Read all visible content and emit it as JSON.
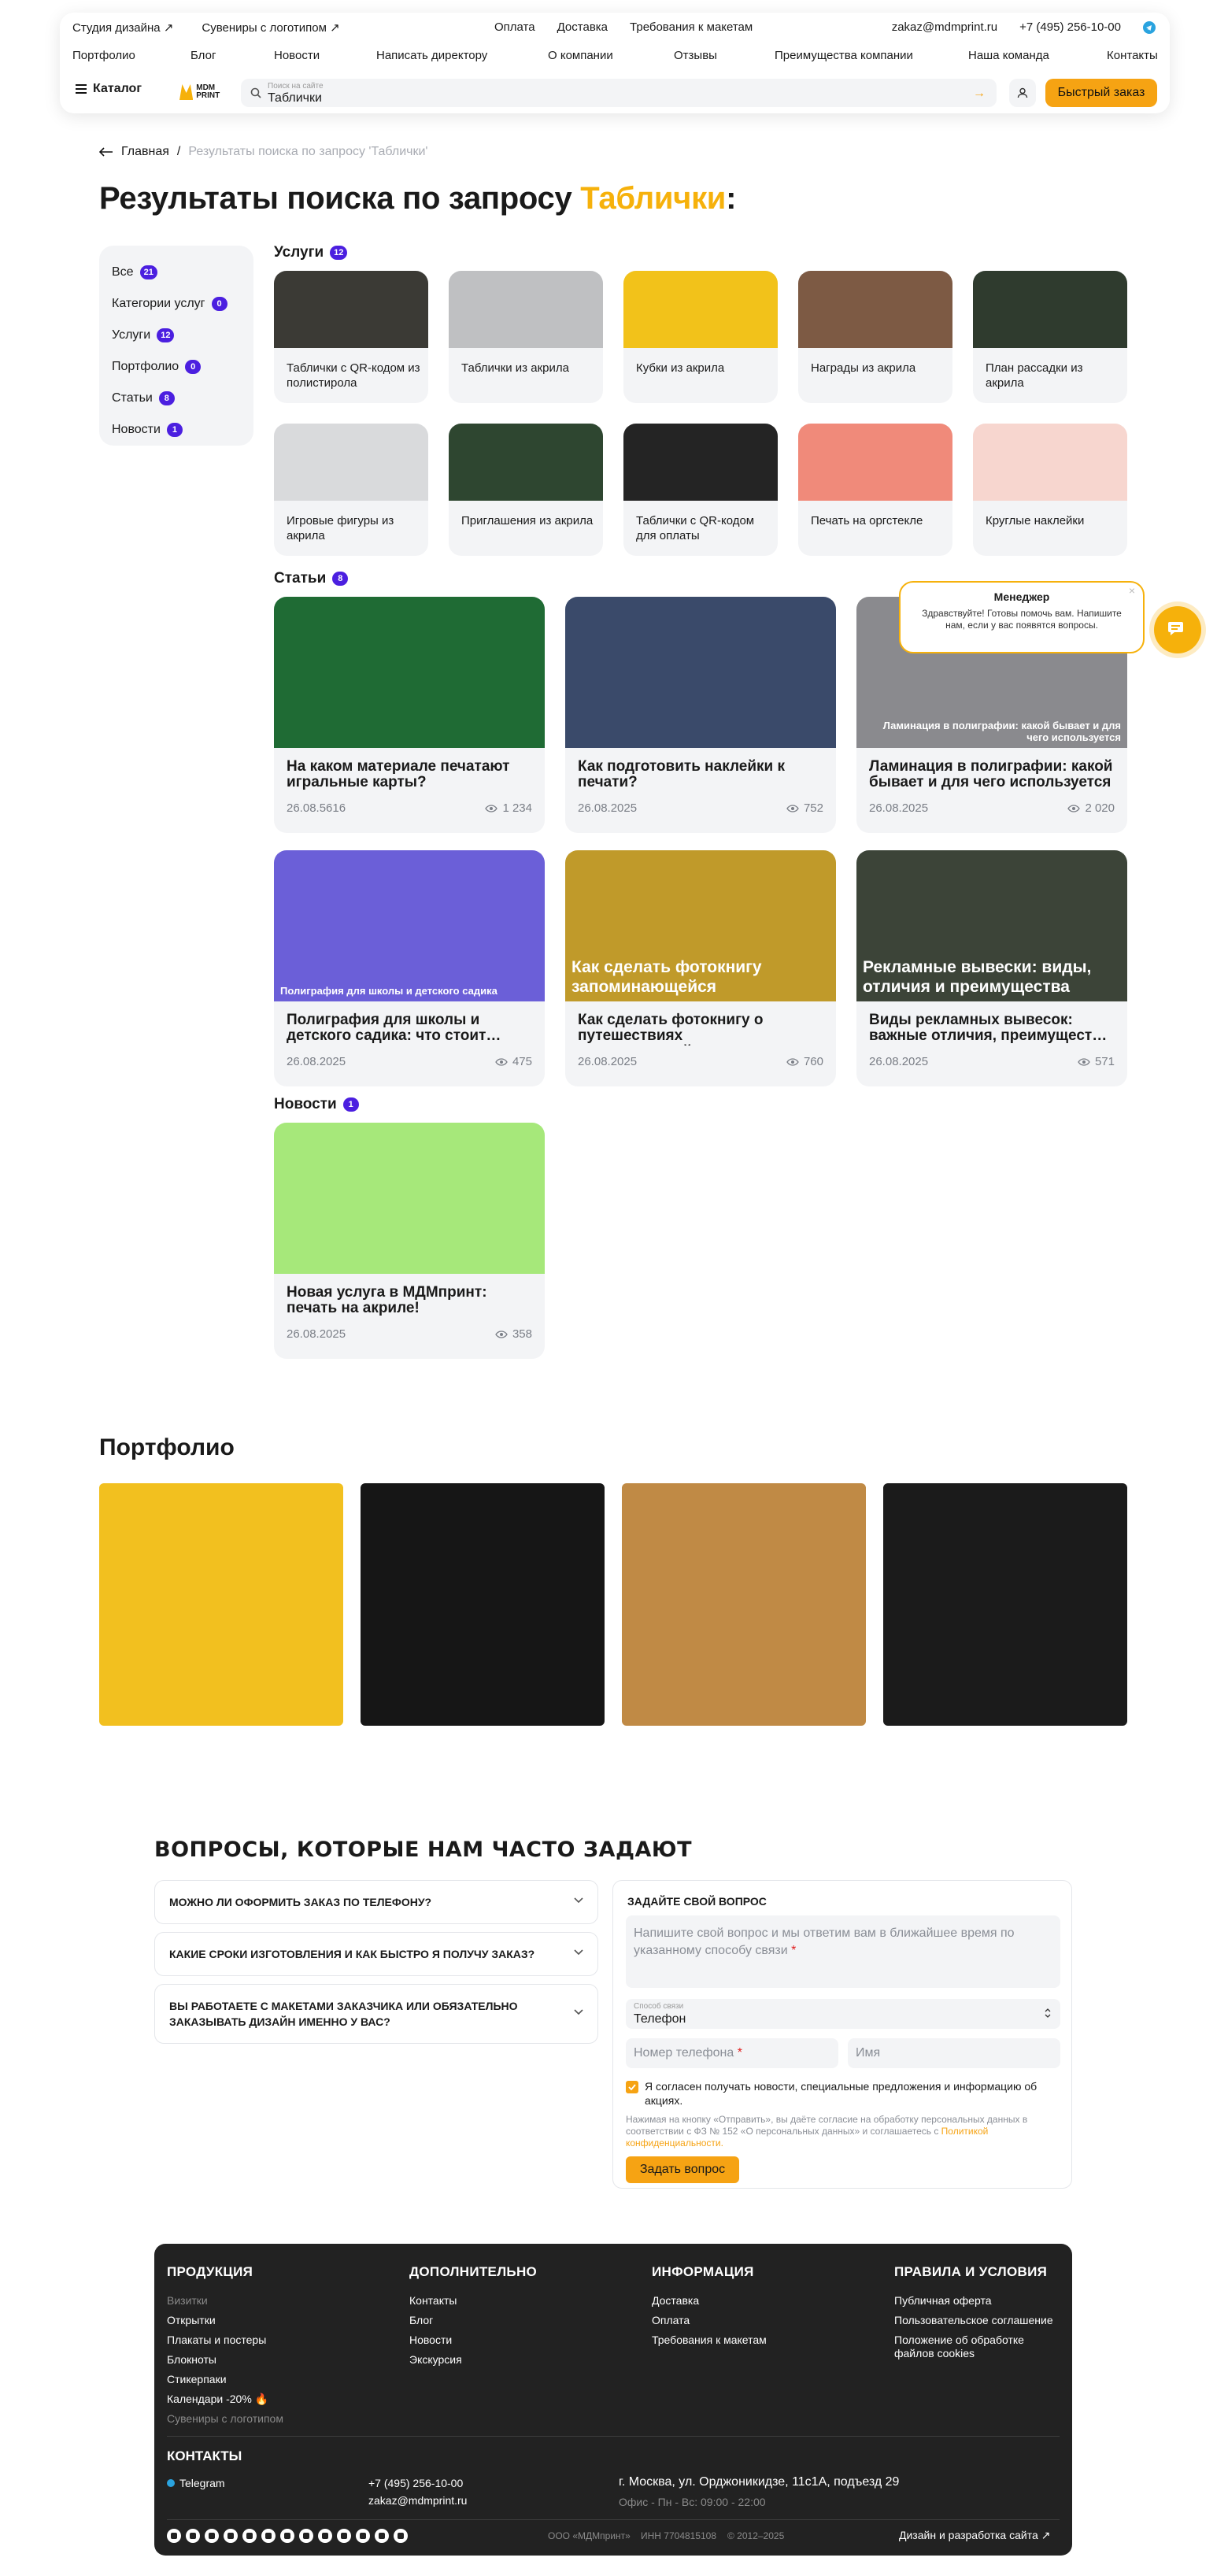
{
  "header": {
    "top_left": [
      "Студия дизайна ↗",
      "Сувениры с логотипом ↗"
    ],
    "top_center": [
      "Оплата",
      "Доставка",
      "Требования к макетам"
    ],
    "email": "zakaz@mdmprint.ru",
    "phone": "+7 (495) 256-10-00",
    "nav": [
      "Портфолио",
      "Блог",
      "Новости",
      "Написать директору",
      "О компании",
      "Отзывы",
      "Преимущества компании",
      "Наша команда",
      "Контакты"
    ],
    "catalog": "Каталог",
    "logo": "MDM PRINT",
    "search_label": "Поиск на сайте",
    "search_value": "Таблички",
    "quick_order": "Быстрый заказ"
  },
  "breadcrumb": {
    "home": "Главная",
    "sep": "/",
    "current": "Результаты поиска по запросу 'Таблички'"
  },
  "title": {
    "text": "Результаты поиска по запросу ",
    "query": "Таблички",
    "colon": ":"
  },
  "filters": [
    {
      "label": "Все",
      "count": "21"
    },
    {
      "label": "Категории услуг",
      "count": "0"
    },
    {
      "label": "Услуги",
      "count": "12"
    },
    {
      "label": "Портфолио",
      "count": "0"
    },
    {
      "label": "Статьи",
      "count": "8"
    },
    {
      "label": "Новости",
      "count": "1"
    }
  ],
  "services": {
    "label": "Услуги",
    "count": "12",
    "items": [
      {
        "title": "Таблички с QR-кодом из полистирола",
        "color": "#3b3a35"
      },
      {
        "title": "Таблички из акрила",
        "color": "#bfc0c2"
      },
      {
        "title": "Кубки из акрила",
        "color": "#f2c21a"
      },
      {
        "title": "Награды из акрила",
        "color": "#7d5a44"
      },
      {
        "title": "План рассадки из акрила",
        "color": "#2f3b2e"
      },
      {
        "title": "Игровые фигуры из акрила",
        "color": "#d9dadc"
      },
      {
        "title": "Приглашения из акрила",
        "color": "#2e4630"
      },
      {
        "title": "Таблички с QR-кодом для оплаты",
        "color": "#242424"
      },
      {
        "title": "Печать на оргстекле",
        "color": "#f08a7a"
      },
      {
        "title": "Круглые наклейки",
        "color": "#f7d6cf"
      }
    ]
  },
  "articles": {
    "label": "Статьи",
    "count": "8",
    "items": [
      {
        "title": "На каком материале печатают игральные карты?",
        "date": "26.08.5616",
        "views": "1 234",
        "color": "#1f6b34",
        "overlay": ""
      },
      {
        "title": "Как подготовить наклейки к печати?",
        "date": "26.08.2025",
        "views": "752",
        "color": "#3a4a6a",
        "overlay": ""
      },
      {
        "title": "Ламинация в полиграфии: какой бывает и для чего используется",
        "date": "26.08.2025",
        "views": "2 020",
        "color": "#8a8a8e",
        "overlay": "Ламинация в полиграфии: какой бывает и для чего используется"
      },
      {
        "title": "Полиграфия для школы и детского садика: что стоит…",
        "date": "26.08.2025",
        "views": "475",
        "color": "#6b5fd8",
        "overlay": "Полиграфия для школы и детского садика"
      },
      {
        "title": "Как сделать фотокнигу о путешествиях запоминающейся…",
        "date": "26.08.2025",
        "views": "760",
        "color": "#c09a2a",
        "overlay": "Как сделать фотокнигу запоминающейся"
      },
      {
        "title": "Виды рекламных вывесок: важные отличия, преимущест…",
        "date": "26.08.2025",
        "views": "571",
        "color": "#3c4438",
        "overlay": "Рекламные вывески: виды, отличия и преимущества"
      }
    ]
  },
  "news": {
    "label": "Новости",
    "count": "1",
    "items": [
      {
        "title": "Новая услуга в МДМпринт: печать на акриле!",
        "date": "26.08.2025",
        "views": "358",
        "color": "#a6e87a"
      }
    ]
  },
  "portfolio": {
    "title": "Портфолио",
    "tiles": [
      "#f2c01f",
      "#161616",
      "#c08a45",
      "#1b1b1b"
    ]
  },
  "faq": {
    "title": "ВОПРОСЫ, КОТОРЫЕ НАМ ЧАСТО ЗАДАЮТ",
    "items": [
      "Можно ли оформить заказ по телефону?",
      "Какие сроки изготовления и как быстро я получу заказ?",
      "Вы работаете с макетами заказчика или обязательно заказывать дизайн именно у вас?"
    ]
  },
  "ask": {
    "title": "Задайте свой вопрос",
    "textarea_placeholder": "Напишите свой вопрос и мы ответим вам в ближайшее время по указанному способу связи",
    "select_label": "Способ связи",
    "select_value": "Телефон",
    "phone_placeholder": "Номер телефона",
    "name_placeholder": "Имя",
    "agree": "Я согласен получать новости, специальные предложения и информацию об акциях.",
    "fine": "Нажимая на кнопку «Отправить», вы даёте согласие на обработку персональных данных в соответствии с ФЗ № 152 «О персональных данных» и соглашаетесь с ",
    "fine_link": "Политикой конфиденциальности.",
    "submit": "Задать вопрос"
  },
  "chat": {
    "title": "Менеджер",
    "message": "Здравствуйте! Готовы помочь вам. Напишите нам, если у вас появятся вопросы.",
    "close": "×"
  },
  "footer": {
    "columns": [
      {
        "title": "Продукция",
        "items": [
          "Визитки",
          "Открытки",
          "Плакаты и постеры",
          "Блокноты",
          "Стикерпаки",
          "Календари -20% 🔥",
          "Сувениры с логотипом"
        ]
      },
      {
        "title": "Дополнительно",
        "items": [
          "Контакты",
          "Блог",
          "Новости",
          "Экскурсия"
        ]
      },
      {
        "title": "Информация",
        "items": [
          "Доставка",
          "Оплата",
          "Требования к макетам"
        ]
      },
      {
        "title": "Правила и условия",
        "items": [
          "Публичная оферта",
          "Пользовательское соглашение",
          "Положение об обработке файлов cookies"
        ]
      }
    ],
    "contacts_title": "Контакты",
    "telegram": "Telegram",
    "phone": "+7 (495) 256-10-00",
    "email": "zakaz@mdmprint.ru",
    "address": "г. Москва, ул. Орджоникидзе, 11с1А, подъезд 29",
    "hours": "Офис - Пн - Вс: 09:00 - 22:00",
    "company": "ООО «МДМпринт»",
    "inn": "ИНН 7704815108",
    "years": "© 2012–2025",
    "dev": "Дизайн и разработка сайта ↗"
  },
  "colors": {
    "accent": "#f6b10b",
    "badge": "#4b1fe0",
    "card": "#f3f4f6"
  }
}
